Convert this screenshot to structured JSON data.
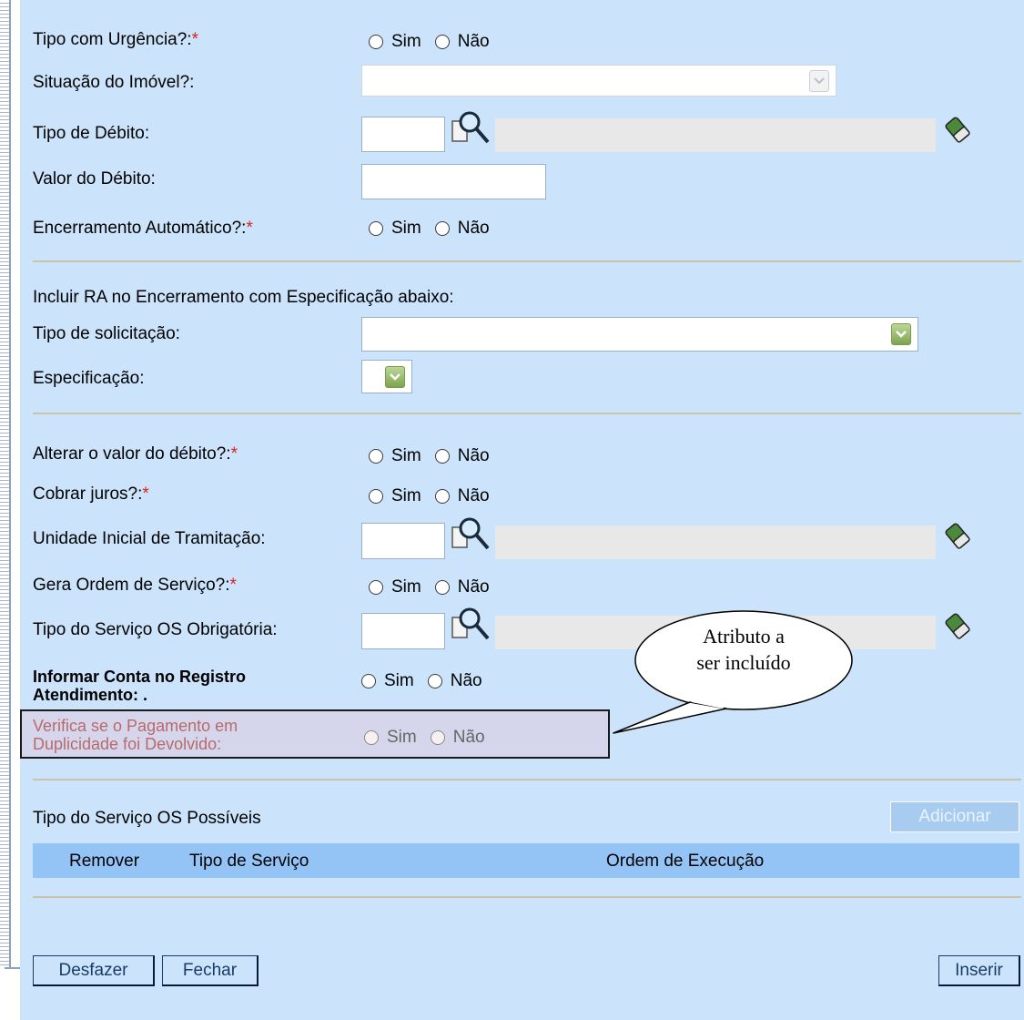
{
  "form": {
    "urgencia": {
      "label": "Tipo com Urgência?:",
      "req": "*",
      "sim": "Sim",
      "nao": "Não"
    },
    "situacao_imovel": {
      "label": "Situação do Imóvel?:"
    },
    "tipo_debito": {
      "label": "Tipo de Débito:"
    },
    "valor_debito": {
      "label": "Valor do Débito:"
    },
    "encerramento": {
      "label": "Encerramento Automático?:",
      "req": "*",
      "sim": "Sim",
      "nao": "Não"
    },
    "incluir_ra": {
      "label": "Incluir RA no Encerramento com Especificação abaixo:"
    },
    "tipo_solicitacao": {
      "label": "Tipo de solicitação:"
    },
    "especificacao": {
      "label": "Especificação:"
    },
    "alterar_valor": {
      "label": "Alterar o valor do débito?:",
      "req": "*",
      "sim": "Sim",
      "nao": "Não"
    },
    "cobrar_juros": {
      "label": "Cobrar juros?:",
      "req": "*",
      "sim": "Sim",
      "nao": "Não"
    },
    "unidade_inicial": {
      "label": "Unidade Inicial de Tramitação:"
    },
    "gera_os": {
      "label": "Gera Ordem de Serviço?:",
      "req": "*",
      "sim": "Sim",
      "nao": "Não"
    },
    "tipo_servico_obrig": {
      "label": "Tipo do Serviço OS Obrigatória:"
    },
    "informar_conta": {
      "label_line1": "Informar Conta no Registro",
      "label_line2": "Atendimento:",
      "suffix": ".",
      "sim": "Sim",
      "nao": "Não"
    },
    "verifica_pagamento": {
      "label_line1": "Verifica se o Pagamento em",
      "label_line2": "Duplicidade foi Devolvido:",
      "sim": "Sim",
      "nao": "Não"
    }
  },
  "callout": {
    "line1": "Atributo a",
    "line2": "ser incluído"
  },
  "servicos": {
    "title": "Tipo do Serviço OS Possíveis",
    "add_label": "Adicionar",
    "columns": [
      "Remover",
      "Tipo de Serviço",
      "Ordem de Execução"
    ]
  },
  "buttons": {
    "desfazer": "Desfazer",
    "fechar": "Fechar",
    "inserir": "Inserir"
  },
  "icons": {
    "search": "magnifier-icon",
    "clear": "eraser-icon"
  }
}
